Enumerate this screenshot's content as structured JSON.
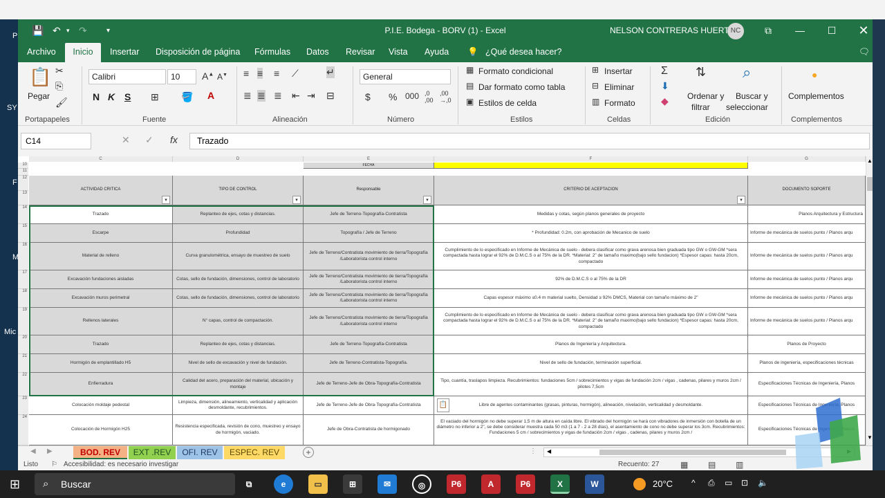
{
  "window": {
    "title": "P.I.E. Bodega - BORV (1)  -  Excel",
    "user_name": "NELSON CONTRERAS HUERTA",
    "user_initials": "NC"
  },
  "menu": {
    "items": [
      "Archivo",
      "Inicio",
      "Insertar",
      "Disposición de página",
      "Fórmulas",
      "Datos",
      "Revisar",
      "Vista",
      "Ayuda"
    ],
    "tell_me": "¿Qué desea hacer?"
  },
  "ribbon": {
    "paste": "Pegar",
    "clipboard": "Portapapeles",
    "font_name": "Calibri",
    "font_size": "10",
    "bold": "N",
    "italic": "K",
    "underline": "S",
    "font_group": "Fuente",
    "alignment_group": "Alineación",
    "number_format": "General",
    "number_group": "Número",
    "conditional_format": "Formato condicional",
    "format_as_table": "Dar formato como tabla",
    "cell_styles": "Estilos de celda",
    "styles_group": "Estilos",
    "insert": "Insertar",
    "delete": "Eliminar",
    "format": "Formato",
    "cells_group": "Celdas",
    "sort_filter_1": "Ordenar y",
    "sort_filter_2": "filtrar",
    "find_select_1": "Buscar y",
    "find_select_2": "seleccionar",
    "edit_group": "Edición",
    "addins": "Complementos",
    "addins_group": "Complementos"
  },
  "formula_bar": {
    "name_box": "C14",
    "fx": "fx",
    "content": "Trazado"
  },
  "grid": {
    "columns": [
      "C",
      "D",
      "E",
      "F",
      "G"
    ],
    "fecha_label": "FECHA",
    "headers": [
      "ACTIVIDAD CRITICA",
      "TIPO DE CONTROL",
      "Responsable",
      "CRITERIO DE ACEPTACION",
      "DOCUMENTO SOPORTE"
    ],
    "row_numbers_top": [
      "10",
      "11",
      "12",
      "13"
    ],
    "rows": [
      {
        "num": "14",
        "c": "Trazado",
        "d": "Replanteo de ejes, cotas y distancias.",
        "e": "Jefe de Terreno-Topografía-Contratista",
        "f": "Medidas y cotas, según planos generales de proyecto",
        "g": "Planos Arquitectura y Estructura"
      },
      {
        "num": "15",
        "c": "Escarpe",
        "d": "Profundidad",
        "e": "Topografía / Jefe de Terreno",
        "f": "* Profundidad: 0.2m, con aprobación de Mecanico de suelo",
        "g": "Informe de mecánica de suelos punto / Planos arqu"
      },
      {
        "num": "16",
        "c": "Material de relleno",
        "d": "Curva granulométrica, ensayo de muestreo de suelo",
        "e": "Jefe de Terreno/Contratista movimiento de tierra/Topografía /Laboratorista control interno",
        "f": "Cumplimiento de lo especificado en Informe de Mecánica de suelo - debera clasificar como grava arenosa bien graduada tipo GW o GW-GM *sera compactada hasta lograr el 92% de D.M.C.S o al 75% de la DR. *Material: 2\" de tamaño maximo(bajo sello fundacion) *Espesor capas: hasta 20cm, compactado",
        "g": "Informe de mecánica de suelos punto / Planos arqu"
      },
      {
        "num": "17",
        "c": "Excavación fundaciones aisladas",
        "d": "Cotas, sello de fundación, dimensiones, control de laboratorio",
        "e": "Jefe de Terreno/Contratista movimiento de tierra/Topografía /Laboratorista control interno",
        "f": "92% de D.M.C.S o al 75% de la DR",
        "g": "Informe de mecánica de suelos punto / Planos arqu"
      },
      {
        "num": "18",
        "c": "Excavación muros perimetral",
        "d": "Cotas, sello de fundación, dimensiones, control de laboratorio",
        "e": "Jefe de Terreno/Contratista movimiento de tierra/Topografía /Laboratorista control interno",
        "f": "Capas espesor máximo ≤0.4 m material suelto, Densidad ≥ 92% DMCS, Material con tamaño máximo de 2\"",
        "g": "Informe de mecánica de suelos punto / Planos arqu"
      },
      {
        "num": "19",
        "c": "Rellenos laterales",
        "d": "N° capas, control de compactación.",
        "e": "Jefe de Terreno/Contratista movimiento de tierra/Topografía /Laboratorista control interno",
        "f": "Cumplimiento de lo especificado en Informe de Mecánica de suelo - debera clasificar como grava arenosa bien graduada tipo GW o GW-GM *sera compactada hasta lograr el 92% de D.M.C.S o al 75% de la DR. *Material: 2\" de tamaño maximo(bajo sello fundacion) *Espesor capas: hasta 20cm, compactado",
        "g": "Informe de mecánica de suelos punto / Planos arqu"
      },
      {
        "num": "20",
        "c": "Trazado",
        "d": "Replanteo de ejes, cotas y distancias.",
        "e": "Jefe de Terreno-Topografía-Contratista",
        "f": "Planos de Ingeniería y Arquitectura.",
        "g": "Planos de Proyecto"
      },
      {
        "num": "21",
        "c": "Hormigón de emplantillado H5",
        "d": "Nivel de sello de excavación y nivel de fundación.",
        "e": "Jefe de Terreno-Contratista-Topografía.",
        "f": "Nivel de sello de fundación, terminación superficial.",
        "g": "Planos de ingeniería, especificaciones técnicas"
      },
      {
        "num": "22",
        "c": "Enfierradura",
        "d": "Calidad del acero, preparación del material, ubicación y montaje",
        "e": "Jefe de Terreno-Jefe de Obra-Topografía-Contratista",
        "f": "Tipo, cuantía, traslapos limpieza. Recubrimientos: fundaciones 5cm / sobrecimientos y vigas de fundación 2cm / vigas , cadenas, pilares y muros 2cm / pilotes 7,5cm",
        "g": "Especificaciones Técnicas de Ingeniería, Planos"
      },
      {
        "num": "23",
        "c": "Colocación moldaje pedestal",
        "d": "Limpieza, dimensión, alineamiento, verticalidad y aplicación desmoldante, recubrimientos.",
        "e": "Jefe de Terreno-Jefe de Obra-Topografía-Contratista",
        "f": "Libre de agentes contaminantes (grasas, pinturas, hormigón), alineación, nivelación, verticalidad y desmoldante.",
        "g": "Especificaciones Técnicas de Ingeniería, Planos"
      },
      {
        "num": "24",
        "c": "Colocación de Hormigón H25",
        "d": "Resistencia especificada, revisión de cono, muestreo y ensayo de hormigón, vaciado.",
        "e": "Jefe de Obra-Contratista de hormigonado",
        "f": "El vaciado del hormigón no debe superar 1,5 m de altura en caída libre. El vibrado del hormigón se hará con vibradores de inmersión con botella de un diámetro no inferior a 2\", se debe considerar muestra cada 50 m3 (1 a 7 - 2 a 28 días), el asentamiento de cono no debe superar los 3cm. Recubrimientos: Fundaciones 5 cm / sobrecimientos y vigas de fundación 2cm / vigas , cadenas, pilares y muros 2cm /",
        "g": "Especificaciones Técnicas de Ingeniería, Planos"
      }
    ]
  },
  "tabs": [
    {
      "label": "BOD. REV",
      "color": "#f4b183",
      "text": "#c00000"
    },
    {
      "label": "EXT .REV",
      "color": "#92d050",
      "text": "#1f4e1f"
    },
    {
      "label": "OFI. REV",
      "color": "#9dc3e6",
      "text": "#1f3864"
    },
    {
      "label": "ESPEC. REV",
      "color": "#ffd966",
      "text": "#5a4a00"
    }
  ],
  "status": {
    "ready": "Listo",
    "accessibility": "Accesibilidad: es necesario investigar",
    "count": "Recuento: 27"
  },
  "taskbar": {
    "search": "Buscar",
    "temperature": "20°C"
  },
  "desktop_labels": [
    "P",
    "SY",
    "F",
    "M",
    "Mic"
  ]
}
